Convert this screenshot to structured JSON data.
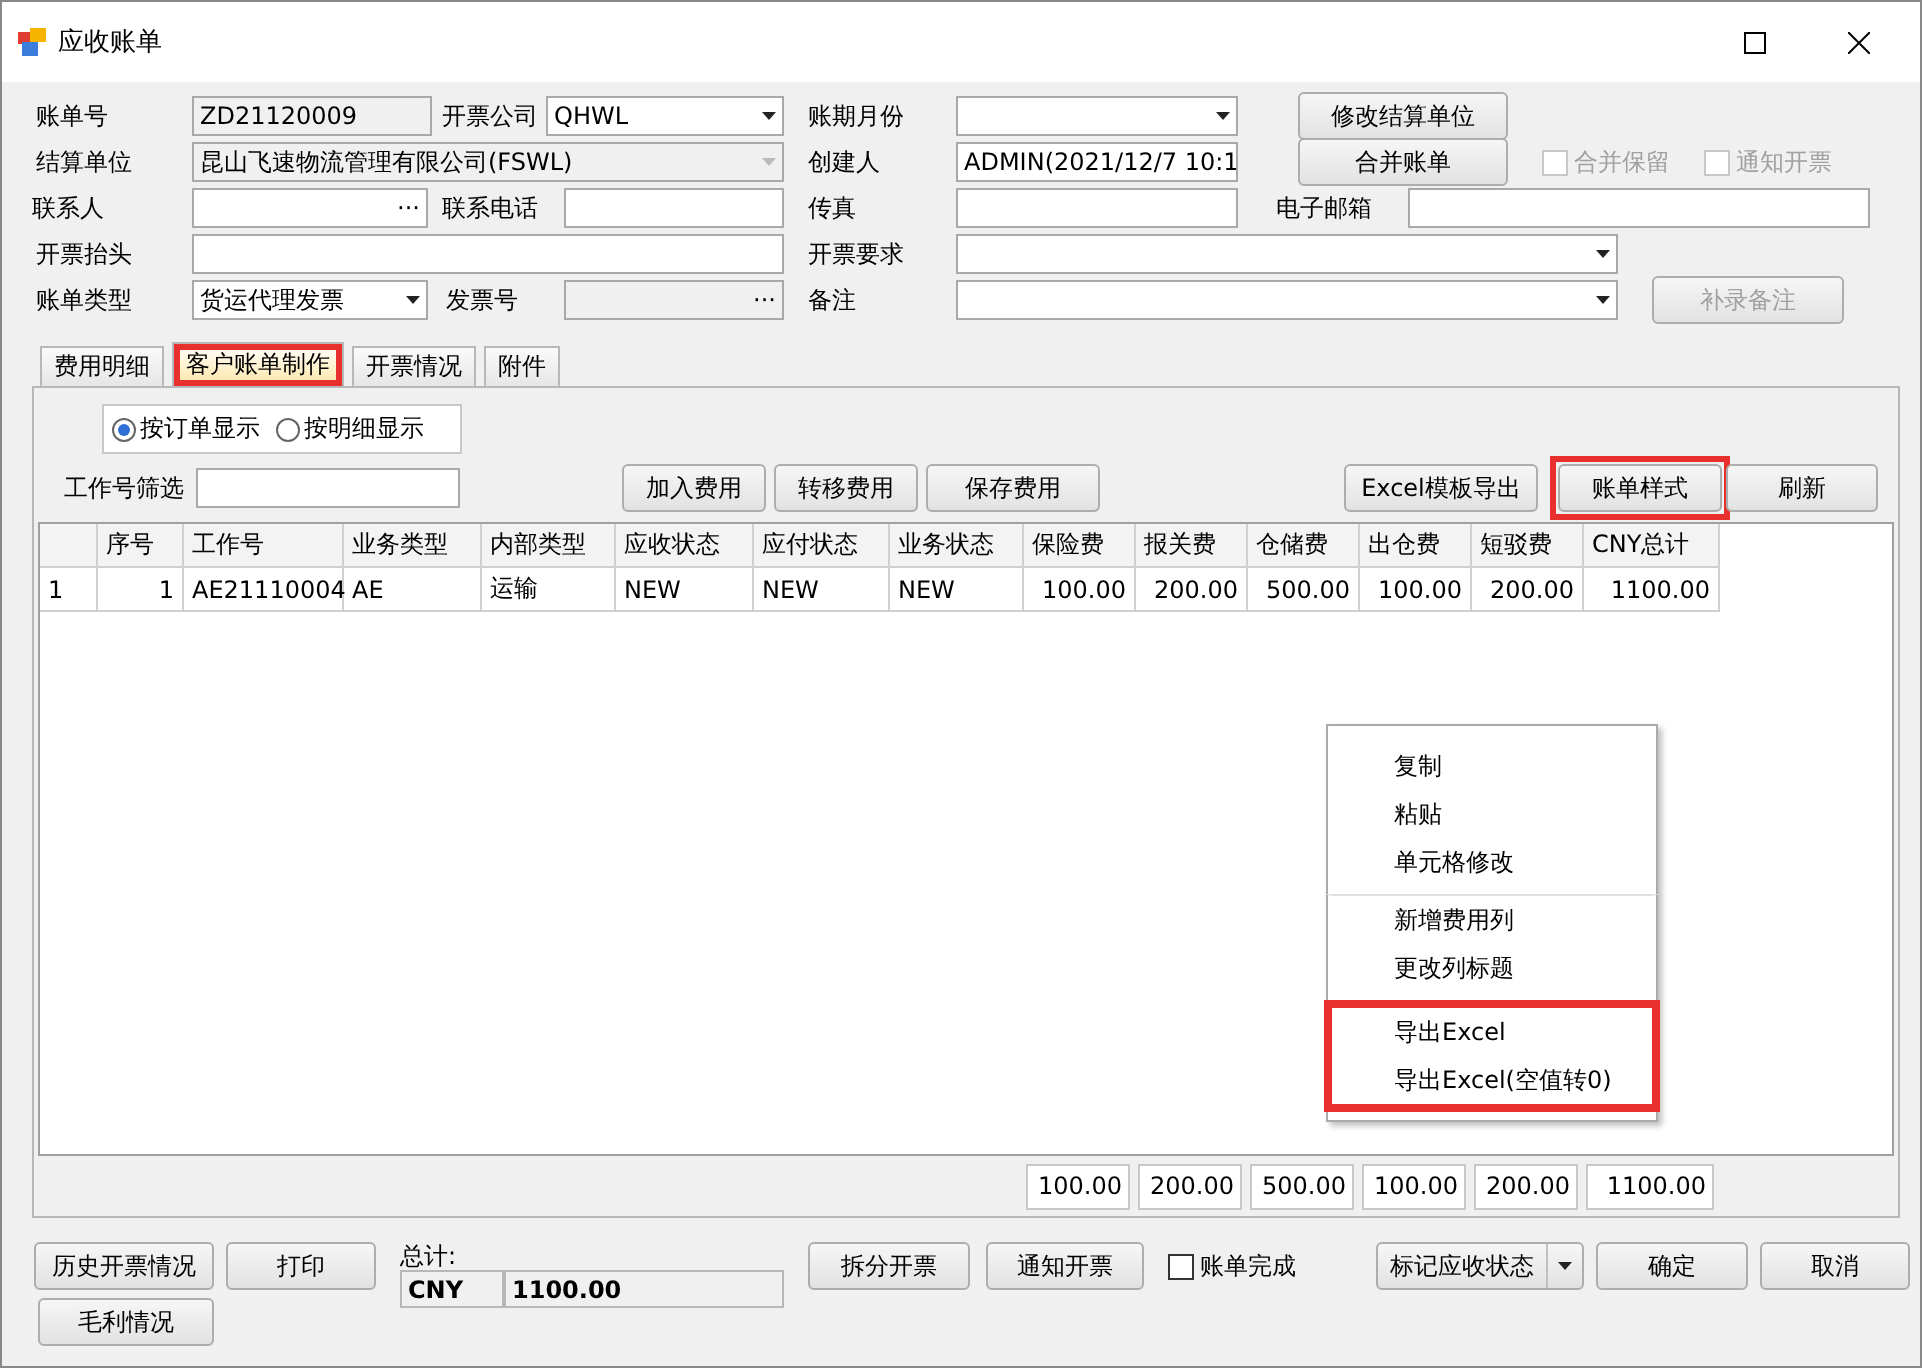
{
  "window": {
    "title": "应收账单"
  },
  "form": {
    "rows": [
      [
        {
          "kind": "label",
          "text": "账单号"
        },
        {
          "kind": "text",
          "value": "ZD21120009",
          "disabled": true
        },
        {
          "kind": "label",
          "text": "开票公司"
        },
        {
          "kind": "combo",
          "value": "QHWL",
          "disabled": false
        },
        {
          "kind": "label",
          "text": "账期月份"
        },
        {
          "kind": "combo",
          "disabled": false
        },
        {
          "kind": "button",
          "label": "修改结算单位",
          "disabled": false
        }
      ],
      [
        {
          "kind": "label",
          "text": "结算单位"
        },
        {
          "kind": "combo",
          "value": "昆山飞速物流管理有限公司(FSWL)",
          "disabled": true
        },
        {
          "kind": "label",
          "text": "创建人"
        },
        {
          "kind": "text",
          "value": "ADMIN(2021/12/7 10:1",
          "disabled": false
        },
        {
          "kind": "button",
          "label": "合并账单",
          "disabled": false
        },
        {
          "kind": "checkbox",
          "label": "合并保留",
          "checked": false,
          "disabled": true
        },
        {
          "kind": "checkbox",
          "label": "通知开票",
          "checked": false,
          "disabled": true
        }
      ],
      [
        {
          "kind": "label",
          "text": "联系人"
        },
        {
          "kind": "lookup",
          "button": "···",
          "disabled": false
        },
        {
          "kind": "label",
          "text": "联系电话"
        },
        {
          "kind": "text",
          "disabled": false
        },
        {
          "kind": "label",
          "text": "传真"
        },
        {
          "kind": "text",
          "disabled": false
        },
        {
          "kind": "label",
          "text": "电子邮箱"
        },
        {
          "kind": "text",
          "disabled": false
        }
      ],
      [
        {
          "kind": "label",
          "text": "开票抬头"
        },
        {
          "kind": "text",
          "disabled": false
        },
        {
          "kind": "label",
          "text": "开票要求"
        },
        {
          "kind": "combo",
          "disabled": false
        }
      ],
      [
        {
          "kind": "label",
          "text": "账单类型"
        },
        {
          "kind": "combo",
          "value": "货运代理发票",
          "disabled": false
        },
        {
          "kind": "label",
          "text": "发票号"
        },
        {
          "kind": "lookup",
          "button": "···",
          "disabled": true
        },
        {
          "kind": "label",
          "text": "备注"
        },
        {
          "kind": "combo",
          "disabled": false
        },
        {
          "kind": "button",
          "label": "补录备注",
          "disabled": true
        }
      ]
    ]
  },
  "tabs": [
    {
      "label": "费用明细",
      "selected": false,
      "highlighted": false
    },
    {
      "label": "客户账单制作",
      "selected": true,
      "highlighted": true
    },
    {
      "label": "开票情况",
      "selected": false,
      "highlighted": false
    },
    {
      "label": "附件",
      "selected": false,
      "highlighted": false
    }
  ],
  "display_mode": [
    {
      "label": "按订单显示",
      "selected": true
    },
    {
      "label": "按明细显示",
      "selected": false
    }
  ],
  "filter": {
    "label": "工作号筛选"
  },
  "actions_left": [
    {
      "label": "加入费用",
      "highlighted": false
    },
    {
      "label": "转移费用",
      "highlighted": false
    },
    {
      "label": "保存费用",
      "highlighted": false
    }
  ],
  "actions_right": [
    {
      "label": "Excel模板导出",
      "highlighted": false
    },
    {
      "label": "账单样式",
      "highlighted": true
    },
    {
      "label": "刷新",
      "highlighted": false
    }
  ],
  "table": {
    "columns": [
      "序号",
      "工作号",
      "业务类型",
      "内部类型",
      "应收状态",
      "应付状态",
      "业务状态",
      "保险费",
      "报关费",
      "仓储费",
      "出仓费",
      "短驳费",
      "CNY总计"
    ],
    "rows": [
      {
        "row_header": "1",
        "cells": [
          "1",
          "AE21110004",
          "AE",
          "运输",
          "NEW",
          "NEW",
          "NEW",
          "100.00",
          "200.00",
          "500.00",
          "100.00",
          "200.00",
          "1100.00"
        ]
      }
    ],
    "totals": [
      "100.00",
      "200.00",
      "500.00",
      "100.00",
      "200.00",
      "1100.00"
    ]
  },
  "context_menu": {
    "groups": [
      {
        "highlighted": false,
        "items": [
          "复制",
          "粘贴",
          "单元格修改"
        ]
      },
      {
        "highlighted": false,
        "items": [
          "新增费用列",
          "更改列标题"
        ]
      },
      {
        "highlighted": true,
        "items": [
          "导出Excel",
          "导出Excel(空值转0)"
        ]
      }
    ]
  },
  "footer": {
    "left_buttons": [
      "历史开票情况",
      "打印",
      "毛利情况"
    ],
    "total_label": "总计:",
    "currency": "CNY",
    "total": "1100.00",
    "mid_buttons": [
      "拆分开票",
      "通知开票"
    ],
    "done": {
      "label": "账单完成",
      "checked": false
    },
    "status_button": "标记应收状态",
    "ok": "确定",
    "cancel": "取消"
  }
}
